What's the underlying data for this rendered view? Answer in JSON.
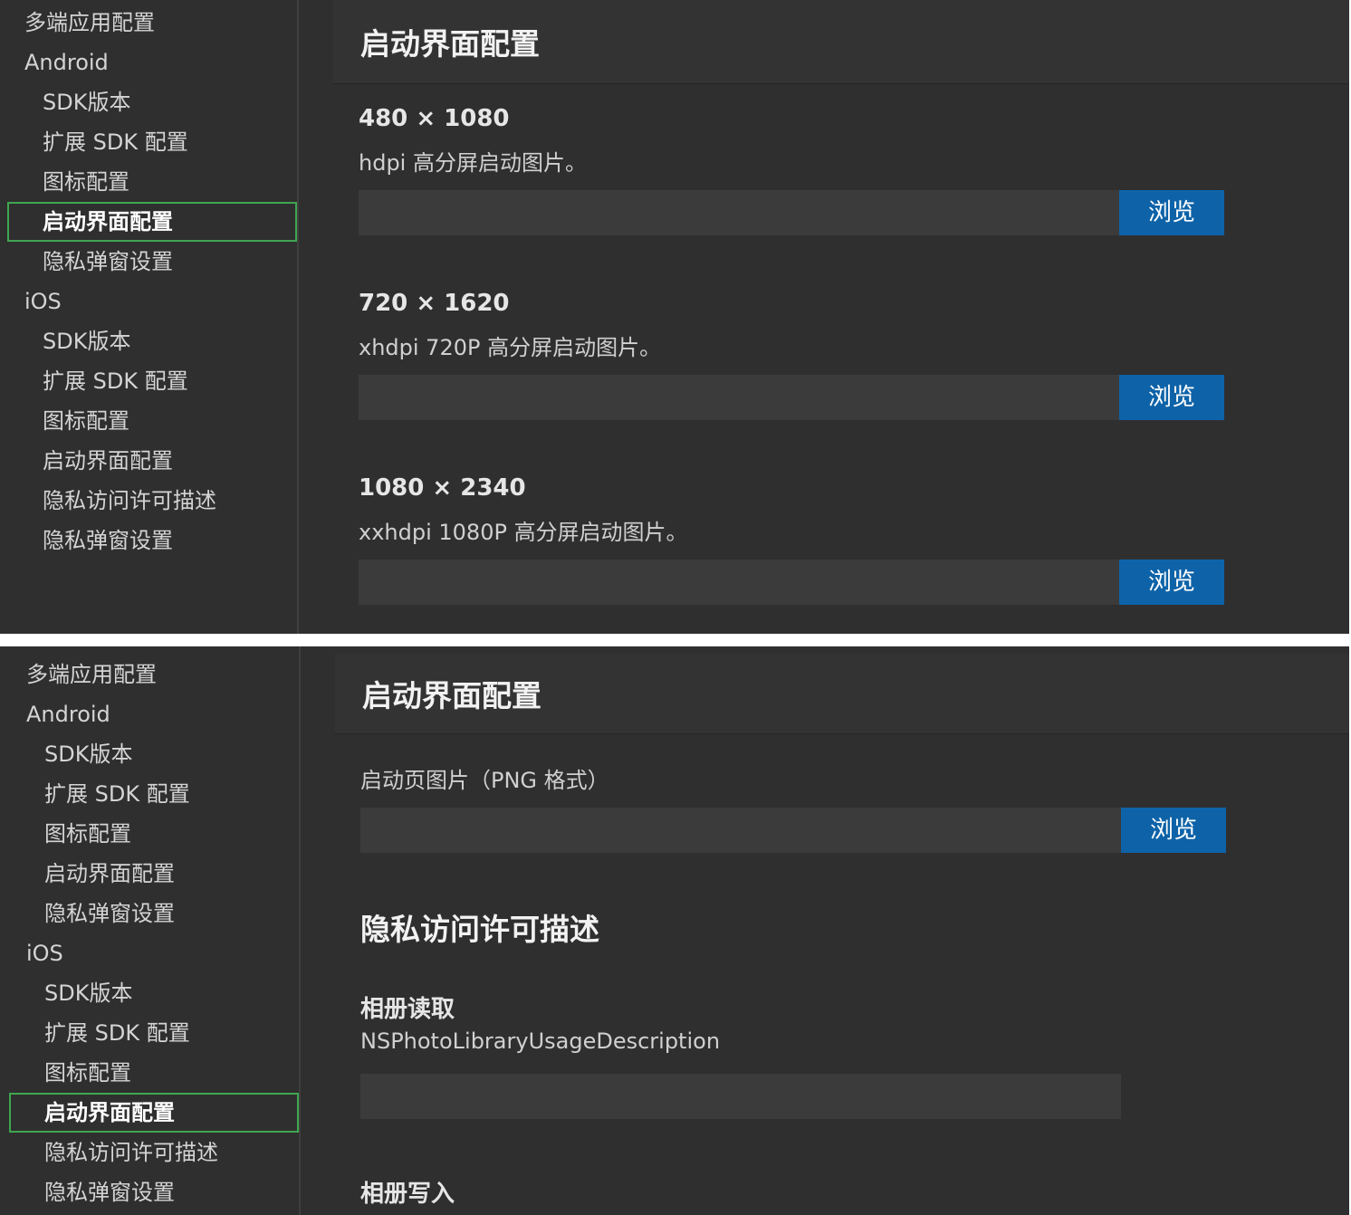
{
  "top_panel": {
    "sidebar": [
      {
        "label": "多端应用配置"
      },
      {
        "label": "Android"
      },
      {
        "label": "SDK版本"
      },
      {
        "label": "扩展 SDK 配置"
      },
      {
        "label": "图标配置"
      },
      {
        "label": "启动界面配置"
      },
      {
        "label": "隐私弹窗设置"
      },
      {
        "label": "iOS"
      },
      {
        "label": "SDK版本"
      },
      {
        "label": "扩展 SDK 配置"
      },
      {
        "label": "图标配置"
      },
      {
        "label": "启动界面配置"
      },
      {
        "label": "隐私访问许可描述"
      },
      {
        "label": "隐私弹窗设置"
      }
    ],
    "page_title": "启动界面配置",
    "fields": [
      {
        "title": "480 × 1080",
        "desc": "hdpi 高分屏启动图片。",
        "value": "",
        "button": "浏览"
      },
      {
        "title": "720 × 1620",
        "desc": "xhdpi 720P 高分屏启动图片。",
        "value": "",
        "button": "浏览"
      },
      {
        "title": "1080 × 2340",
        "desc": "xxhdpi 1080P 高分屏启动图片。",
        "value": "",
        "button": "浏览"
      }
    ]
  },
  "bottom_panel": {
    "sidebar": [
      {
        "label": "多端应用配置"
      },
      {
        "label": "Android"
      },
      {
        "label": "SDK版本"
      },
      {
        "label": "扩展 SDK 配置"
      },
      {
        "label": "图标配置"
      },
      {
        "label": "启动界面配置"
      },
      {
        "label": "隐私弹窗设置"
      },
      {
        "label": "iOS"
      },
      {
        "label": "SDK版本"
      },
      {
        "label": "扩展 SDK 配置"
      },
      {
        "label": "图标配置"
      },
      {
        "label": "启动界面配置"
      },
      {
        "label": "隐私访问许可描述"
      },
      {
        "label": "隐私弹窗设置"
      }
    ],
    "page_title": "启动界面配置",
    "launch_image": {
      "desc": "启动页图片（PNG 格式）",
      "value": "",
      "button": "浏览"
    },
    "privacy_section_title": "隐私访问许可描述",
    "privacy_fields": [
      {
        "title": "相册读取",
        "desc": "NSPhotoLibraryUsageDescription",
        "value": ""
      },
      {
        "title": "相册写入"
      }
    ]
  },
  "colors": {
    "background": "#2f2f2f",
    "active_border": "#3fa650",
    "button": "#0e63a8"
  }
}
